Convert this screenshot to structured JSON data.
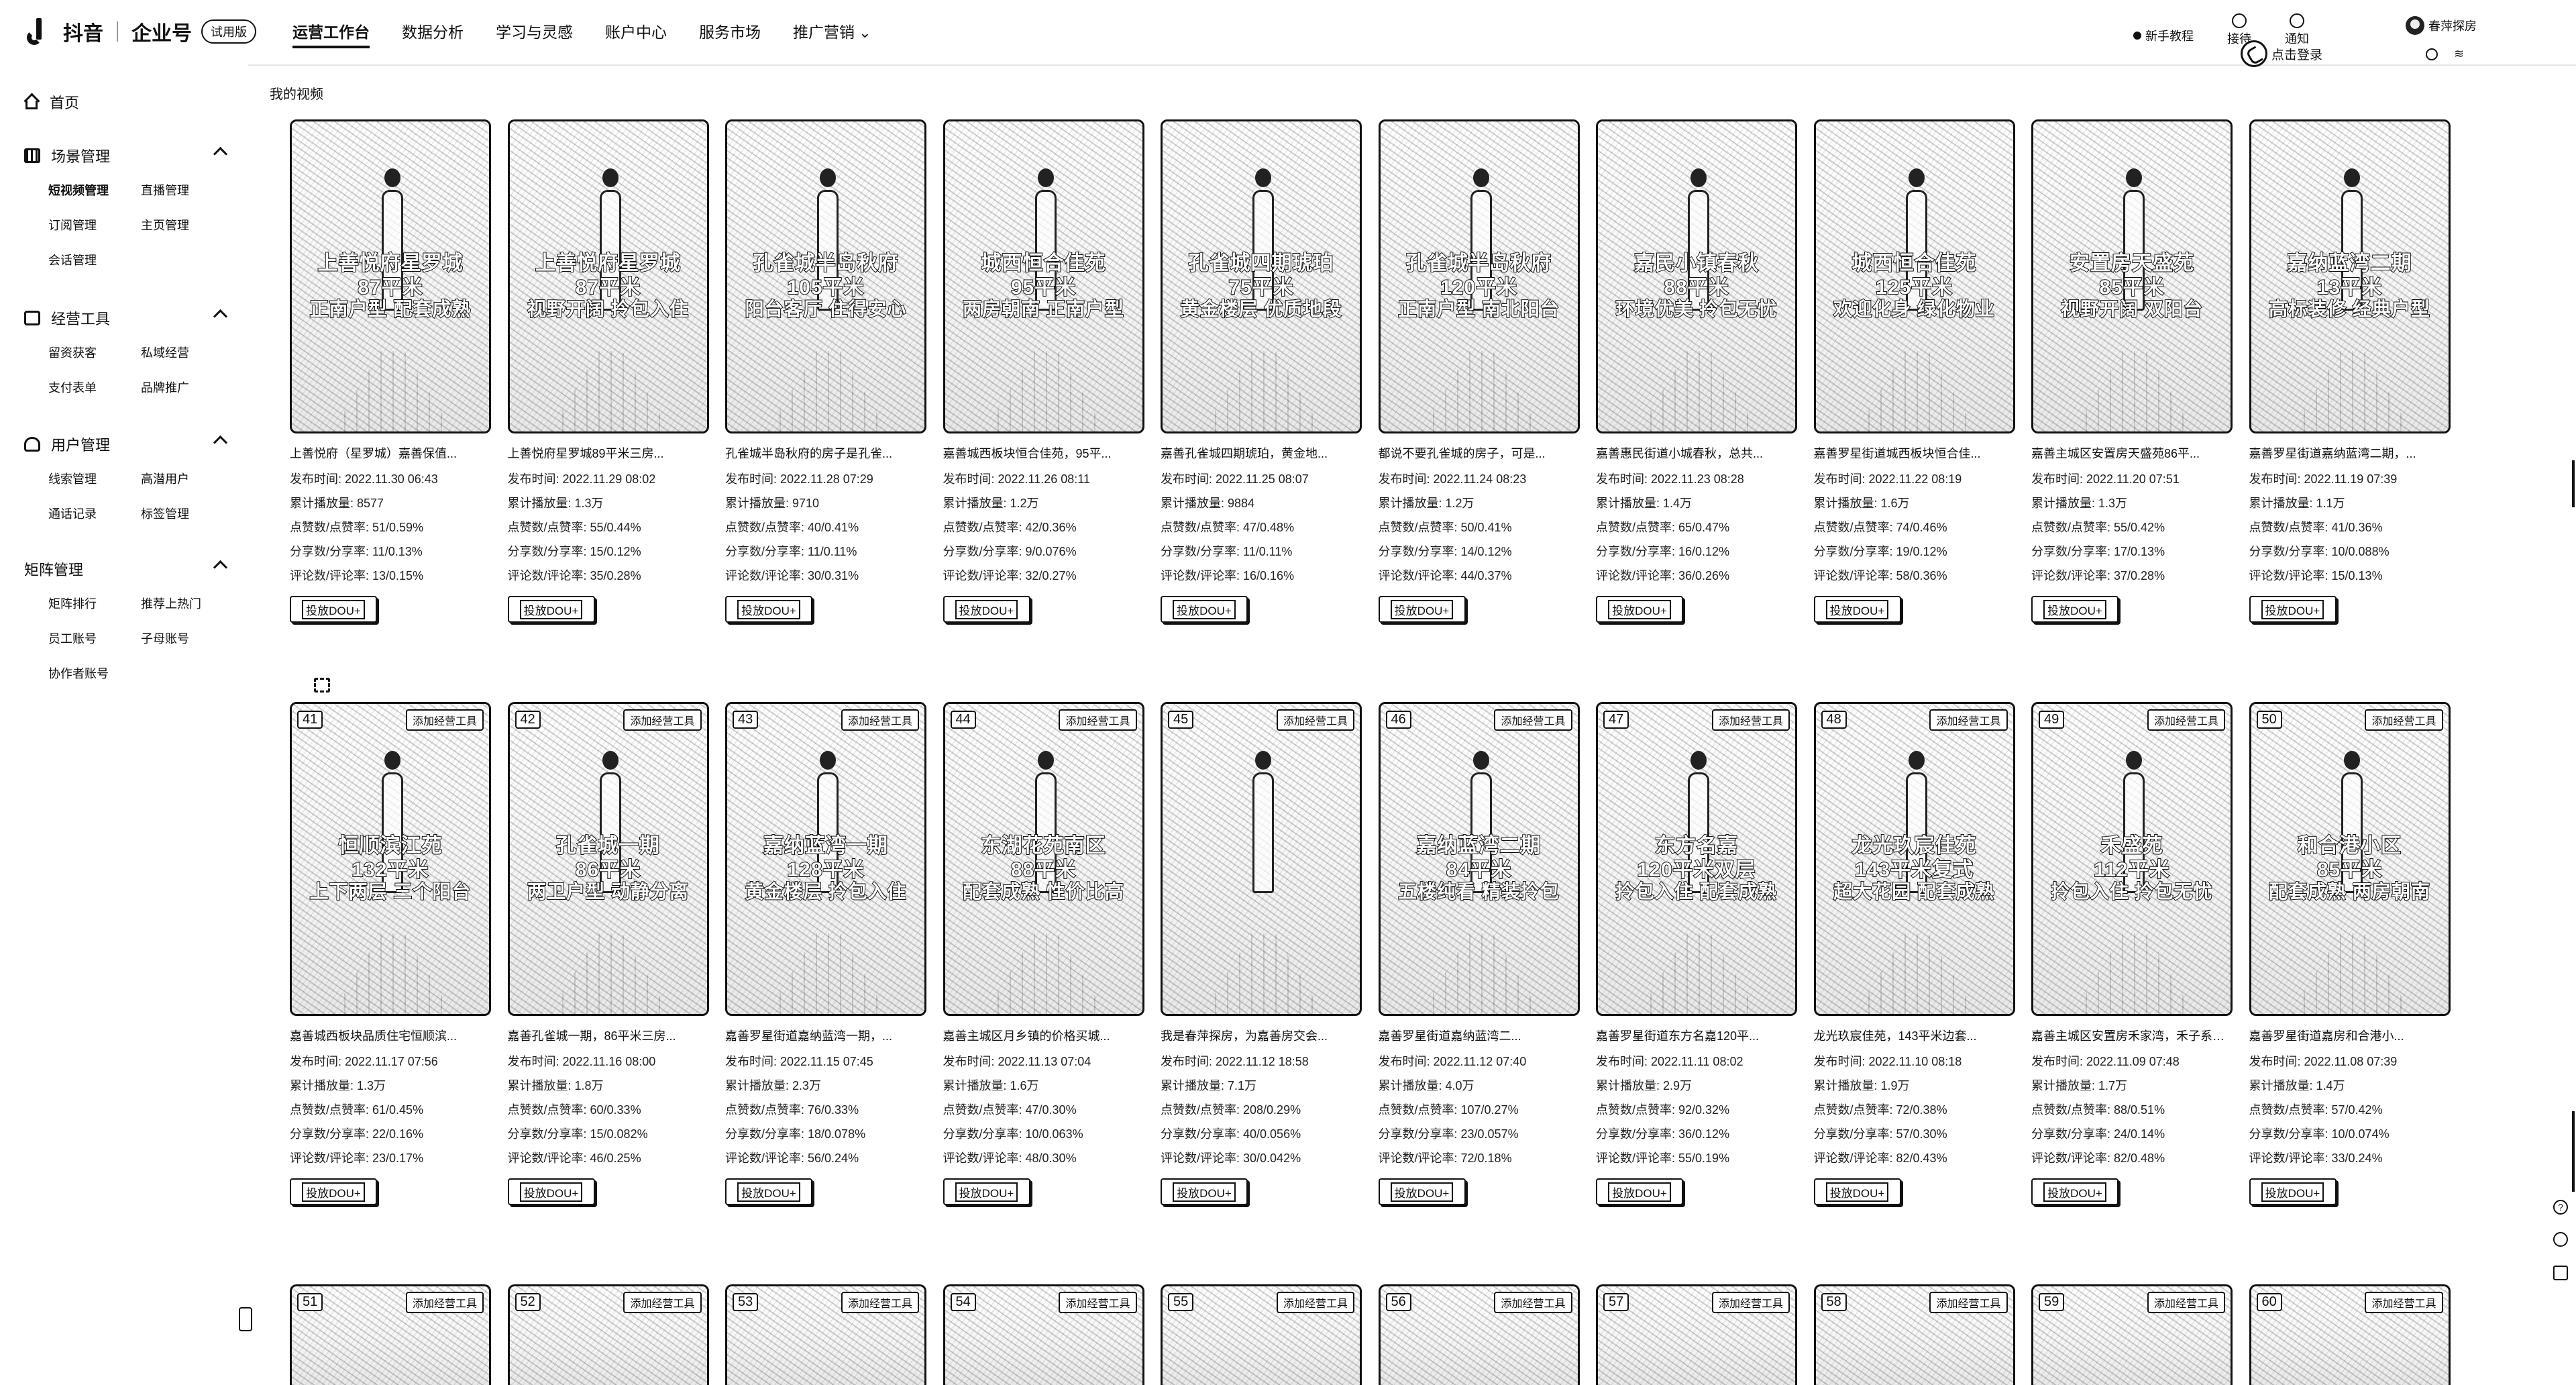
{
  "topbar": {
    "brand": "抖音",
    "product": "企业号",
    "badge": "试用版",
    "nav": [
      {
        "label": "运营工作台",
        "active": true
      },
      {
        "label": "数据分析",
        "active": false
      },
      {
        "label": "学习与灵感",
        "active": false
      },
      {
        "label": "账户中心",
        "active": false
      },
      {
        "label": "服务市场",
        "active": false
      },
      {
        "label": "推广营销",
        "active": false,
        "dropdown": true
      }
    ],
    "right": {
      "tutorial": "新手教程",
      "connect": "接待",
      "notify": "通知",
      "user": "春萍探房",
      "login": "点击登录"
    }
  },
  "sidebar": {
    "home": "首页",
    "groups": [
      {
        "title": "场景管理",
        "icon": "film-icon",
        "items": [
          "短视频管理",
          "直播管理",
          "订阅管理",
          "主页管理",
          "会话管理"
        ],
        "selected": "短视频管理"
      },
      {
        "title": "经营工具",
        "icon": "briefcase-icon",
        "items": [
          "留资获客",
          "私域经营",
          "支付表单",
          "品牌推广"
        ]
      },
      {
        "title": "用户管理",
        "icon": "user-icon",
        "items": [
          "线索管理",
          "高潜用户",
          "通话记录",
          "标签管理"
        ]
      },
      {
        "title": "矩阵管理",
        "icon": "matrix-icon",
        "items": [
          "矩阵排行",
          "推荐上热门",
          "员工账号",
          "子母账号",
          "协作者账号"
        ]
      }
    ]
  },
  "page": {
    "title": "我的视频",
    "dou_label": "投放DOU+",
    "tag_label": "添加经营工具"
  },
  "labels": {
    "publish": "发布时间: ",
    "plays": "累计播放量: ",
    "likes": "点赞数/点赞率: ",
    "shares": "分享数/分享率: ",
    "comments": "评论数/评论率: "
  },
  "videos": [
    {
      "overlay": [
        "上善悦府星罗城",
        "87平米",
        "正南户型 配套成熟"
      ],
      "title": "上善悦府（星罗城）嘉善保值...",
      "date": "2022.11.30 06:43",
      "plays": "8577",
      "likes": "51/0.59%",
      "shares": "11/0.13%",
      "comments": "13/0.15%"
    },
    {
      "overlay": [
        "上善悦府星罗城",
        "87平米",
        "视野开阔 拎包入住"
      ],
      "title": "上善悦府星罗城89平米三房...",
      "date": "2022.11.29 08:02",
      "plays": "1.3万",
      "likes": "55/0.44%",
      "shares": "15/0.12%",
      "comments": "35/0.28%"
    },
    {
      "overlay": [
        "孔雀城半岛秋府",
        "105平米",
        "阳台客厅 住得安心"
      ],
      "title": "孔雀城半岛秋府的房子是孔雀...",
      "date": "2022.11.28 07:29",
      "plays": "9710",
      "likes": "40/0.41%",
      "shares": "11/0.11%",
      "comments": "30/0.31%"
    },
    {
      "overlay": [
        "城西恒合佳苑",
        "95平米",
        "两房朝南 正南户型"
      ],
      "title": "嘉善城西板块恒合佳苑，95平...",
      "date": "2022.11.26 08:11",
      "plays": "1.2万",
      "likes": "42/0.36%",
      "shares": "9/0.076%",
      "comments": "32/0.27%"
    },
    {
      "overlay": [
        "孔雀城四期琥珀",
        "75平米",
        "黄金楼层 优质地段"
      ],
      "title": "嘉善孔雀城四期琥珀，黄金地...",
      "date": "2022.11.25 08:07",
      "plays": "9884",
      "likes": "47/0.48%",
      "shares": "11/0.11%",
      "comments": "16/0.16%"
    },
    {
      "overlay": [
        "孔雀城半岛秋府",
        "120平米",
        "正南户型 南北阳台"
      ],
      "title": "都说不要孔雀城的房子，可是...",
      "date": "2022.11.24 08:23",
      "plays": "1.2万",
      "likes": "50/0.41%",
      "shares": "14/0.12%",
      "comments": "44/0.37%"
    },
    {
      "overlay": [
        "嘉民小镇春秋",
        "88平米",
        "环境优美 拎包无忧"
      ],
      "title": "嘉善惠民街道小城春秋，总共...",
      "date": "2022.11.23 08:28",
      "plays": "1.4万",
      "likes": "65/0.47%",
      "shares": "16/0.12%",
      "comments": "36/0.26%"
    },
    {
      "overlay": [
        "城西恒合佳苑",
        "125平米",
        "欢迎化身 绿化物业"
      ],
      "title": "嘉善罗星街道城西板块恒合佳...",
      "date": "2022.11.22 08:19",
      "plays": "1.6万",
      "likes": "74/0.46%",
      "shares": "19/0.12%",
      "comments": "58/0.36%"
    },
    {
      "overlay": [
        "安置房天盛苑",
        "85平米",
        "视野开阔 双阳台"
      ],
      "title": "嘉善主城区安置房天盛苑86平...",
      "date": "2022.11.20 07:51",
      "plays": "1.3万",
      "likes": "55/0.42%",
      "shares": "17/0.13%",
      "comments": "37/0.28%"
    },
    {
      "overlay": [
        "嘉纳蓝湾二期",
        "13平米",
        "高标装修 经典户型"
      ],
      "title": "嘉善罗星街道嘉纳蓝湾二期，...",
      "date": "2022.11.19 07:39",
      "plays": "1.1万",
      "likes": "41/0.36%",
      "shares": "10/0.088%",
      "comments": "15/0.13%"
    },
    {
      "num": "41",
      "overlay": [
        "恒顺滨江苑",
        "132平米",
        "上下两层 三个阳台"
      ],
      "title": "嘉善城西板块品质住宅恒顺滨...",
      "date": "2022.11.17 07:56",
      "plays": "1.3万",
      "likes": "61/0.45%",
      "shares": "22/0.16%",
      "comments": "23/0.17%"
    },
    {
      "num": "42",
      "overlay": [
        "孔雀城一期",
        "86平米",
        "两卫户型 动静分离"
      ],
      "title": "嘉善孔雀城一期，86平米三房...",
      "date": "2022.11.16 08:00",
      "plays": "1.8万",
      "likes": "60/0.33%",
      "shares": "15/0.082%",
      "comments": "46/0.25%"
    },
    {
      "num": "43",
      "overlay": [
        "嘉纳蓝湾一期",
        "128平米",
        "黄金楼层 拎包入住"
      ],
      "title": "嘉善罗星街道嘉纳蓝湾一期，...",
      "date": "2022.11.15 07:45",
      "plays": "2.3万",
      "likes": "76/0.33%",
      "shares": "18/0.078%",
      "comments": "56/0.24%"
    },
    {
      "num": "44",
      "overlay": [
        "东湖花苑南区",
        "88平米",
        "配套成熟 性价比高"
      ],
      "title": "嘉善主城区月乡镇的价格买城...",
      "date": "2022.11.13 07:04",
      "plays": "1.6万",
      "likes": "47/0.30%",
      "shares": "10/0.063%",
      "comments": "48/0.30%"
    },
    {
      "num": "45",
      "overlay": [
        "",
        "",
        ""
      ],
      "title": "我是春萍探房，为嘉善房交会...",
      "date": "2022.11.12 18:58",
      "plays": "7.1万",
      "likes": "208/0.29%",
      "shares": "40/0.056%",
      "comments": "30/0.042%"
    },
    {
      "num": "46",
      "overlay": [
        "嘉纳蓝湾二期",
        "84平米",
        "五楼纯看 精装拎包"
      ],
      "title": "嘉善罗星街道嘉纳蓝湾二...",
      "date": "2022.11.12 07:40",
      "plays": "4.0万",
      "likes": "107/0.27%",
      "shares": "23/0.057%",
      "comments": "72/0.18%"
    },
    {
      "num": "47",
      "overlay": [
        "东方名嘉",
        "120平米双层",
        "拎包入住 配套成熟"
      ],
      "title": "嘉善罗星街道东方名嘉120平...",
      "date": "2022.11.11 08:02",
      "plays": "2.9万",
      "likes": "92/0.32%",
      "shares": "36/0.12%",
      "comments": "55/0.19%"
    },
    {
      "num": "48",
      "overlay": [
        "龙光玖宸佳苑",
        "143平米复式",
        "超大花园 配套成熟"
      ],
      "title": "龙光玖宸佳苑，143平米边套...",
      "date": "2022.11.10 08:18",
      "plays": "1.9万",
      "likes": "72/0.38%",
      "shares": "57/0.30%",
      "comments": "82/0.43%"
    },
    {
      "num": "49",
      "overlay": [
        "禾盛苑",
        "112平米",
        "拎包入住 拎包无忧"
      ],
      "title": "嘉善主城区安置房禾家湾，禾子系星...",
      "date": "2022.11.09 07:48",
      "plays": "1.7万",
      "likes": "88/0.51%",
      "shares": "24/0.14%",
      "comments": "82/0.48%"
    },
    {
      "num": "50",
      "overlay": [
        "和合港小区",
        "85平米",
        "配套成熟 两房朝南"
      ],
      "title": "嘉善罗星街道嘉房和合港小...",
      "date": "2022.11.08 07:39",
      "plays": "1.4万",
      "likes": "57/0.42%",
      "shares": "10/0.074%",
      "comments": "33/0.24%"
    }
  ],
  "partial_row": [
    "51",
    "52",
    "53",
    "54",
    "55",
    "56",
    "57",
    "58",
    "59",
    "60"
  ]
}
